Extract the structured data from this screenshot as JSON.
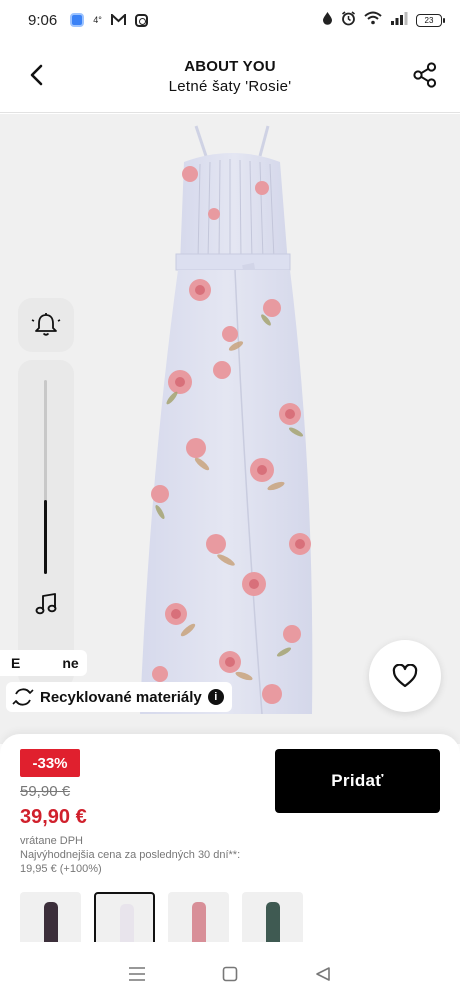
{
  "status_bar": {
    "time": "9:06",
    "network_label": "4°",
    "battery_level": "23",
    "icons": [
      "app-icon",
      "mail-icon",
      "instagram-icon",
      "drop-icon",
      "alarm-icon",
      "wifi-icon",
      "signal-icon",
      "battery-icon"
    ]
  },
  "header": {
    "brand": "ABOUT YOU",
    "product_name": "Letné šaty 'Rosie'",
    "back_icon": "chevron-left-icon",
    "share_icon": "share-icon"
  },
  "image": {
    "background_color": "#f0f0f0",
    "dress_color": "#dcdff0",
    "print_colors": [
      "#e89aa0",
      "#d8707a",
      "#c9a47e",
      "#a3a16a"
    ]
  },
  "side_panel": {
    "bell_icon": "bell-icon",
    "music_icon": "music-note-icon",
    "dots_icon": "more-dots-icon",
    "slider_level": 0.38
  },
  "badges": {
    "partial_label": "E   ne",
    "recycled_label": "Recyklované materiály",
    "info_glyph": "i",
    "recycle_icon": "recycle-icon"
  },
  "wishlist": {
    "icon": "heart-icon"
  },
  "pricing": {
    "discount": "-33%",
    "old_price": "59,90 €",
    "new_price": "39,90 €",
    "vat_note": "vrátane DPH",
    "lowest_price_note": "Najvýhodnejšia cena za posledných 30 dní**: 19,95 € (+100%)",
    "accent_color": "#e0202e"
  },
  "actions": {
    "add_label": "Pridať"
  },
  "thumbnails": [
    {
      "color": "#3c2f3b",
      "selected": false
    },
    {
      "color": "#e8e4ec",
      "selected": true
    },
    {
      "color": "#d88f98",
      "selected": false
    },
    {
      "color": "#3f5a52",
      "selected": false
    }
  ],
  "nav_bar": {
    "icons": [
      "menu-icon",
      "home-square-icon",
      "back-triangle-icon"
    ]
  }
}
